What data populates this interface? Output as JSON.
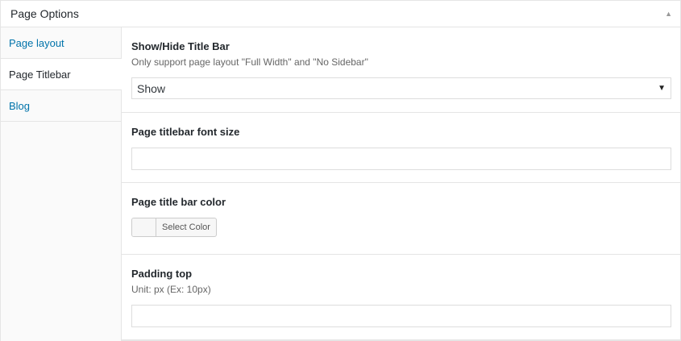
{
  "metabox": {
    "title": "Page Options",
    "toggle_icon": "collapse-arrow-up-icon"
  },
  "tabs": [
    {
      "label": "Page layout",
      "active": false
    },
    {
      "label": "Page Titlebar",
      "active": true
    },
    {
      "label": "Blog",
      "active": false
    }
  ],
  "fields": {
    "title_bar": {
      "label": "Show/Hide Title Bar",
      "description": "Only support page layout \"Full Width\" and \"No Sidebar\"",
      "selected": "Show"
    },
    "font_size": {
      "label": "Page titlebar font size",
      "value": ""
    },
    "title_bar_color": {
      "label": "Page title bar color",
      "button_label": "Select Color"
    },
    "padding_top": {
      "label": "Padding top",
      "description": "Unit: px (Ex: 10px)",
      "value": ""
    }
  },
  "colors": {
    "link": "#0073aa",
    "border": "#e5e5e5",
    "text": "#23282d"
  }
}
